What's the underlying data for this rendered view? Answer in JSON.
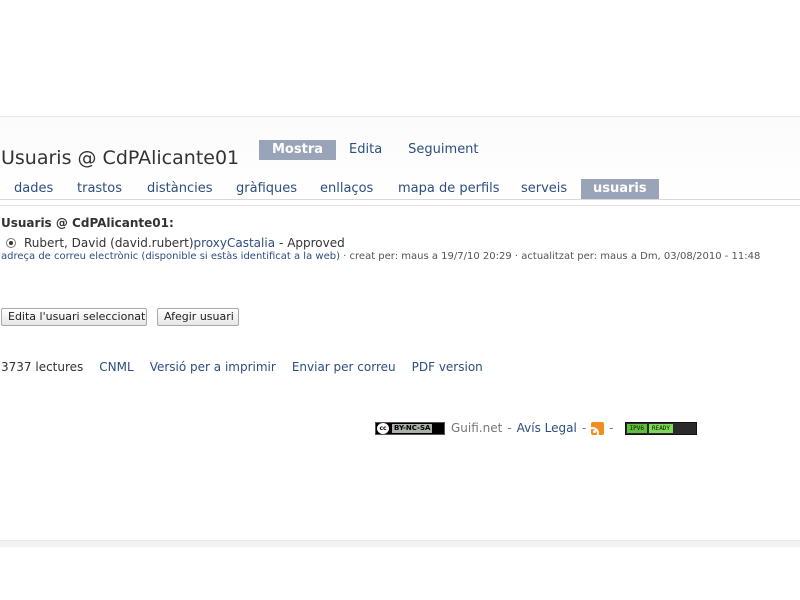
{
  "page": {
    "title": "Usuaris @ CdPAlicante01"
  },
  "primary_tabs": [
    {
      "label": "Mostra",
      "active": true
    },
    {
      "label": "Edita",
      "active": false
    },
    {
      "label": "Seguiment",
      "active": false
    }
  ],
  "secondary_tabs": [
    {
      "label": "dades",
      "active": false
    },
    {
      "label": "trastos",
      "active": false
    },
    {
      "label": "distàncies",
      "active": false
    },
    {
      "label": "gràfiques",
      "active": false
    },
    {
      "label": "enllaços",
      "active": false
    },
    {
      "label": "mapa de perfils",
      "active": false
    },
    {
      "label": "serveis",
      "active": false
    },
    {
      "label": "usuaris",
      "active": true
    }
  ],
  "users_section": {
    "heading": "Usuaris @ CdPAlicante01:",
    "user": {
      "name": "Rubert, David (david.rubert)",
      "proxy": "proxyCastalia",
      "status": "- Approved",
      "selected": true,
      "email_note": "adreça de correu electrònic (disponible si estàs identificat a la web)",
      "meta": "· creat per: maus a 19/7/10 20:29 · actualitzat per: maus a Dm, 03/08/2010 - 11:48"
    }
  },
  "buttons": {
    "edit_selected": "Edita l'usuari seleccionat",
    "add_user": "Afegir usuari"
  },
  "links": {
    "reads": "3737 lectures",
    "cnml": "CNML",
    "print": "Versió per a imprimir",
    "email": "Enviar per correu",
    "pdf": "PDF version"
  },
  "footer": {
    "cc_text": "BY-NC-SA",
    "cc_symbol": "cc",
    "site": "Guifi.net",
    "sep1": "-",
    "legal": "Avís Legal",
    "sep2": "-",
    "sep3": "-",
    "ipv6_a": "IPV6",
    "ipv6_b": "READY",
    "rss_icon": "rss-feed-icon"
  },
  "colors": {
    "link": "#2d4e7e",
    "active_tab": "#9aa4b8",
    "rss": "#f28d1f"
  }
}
